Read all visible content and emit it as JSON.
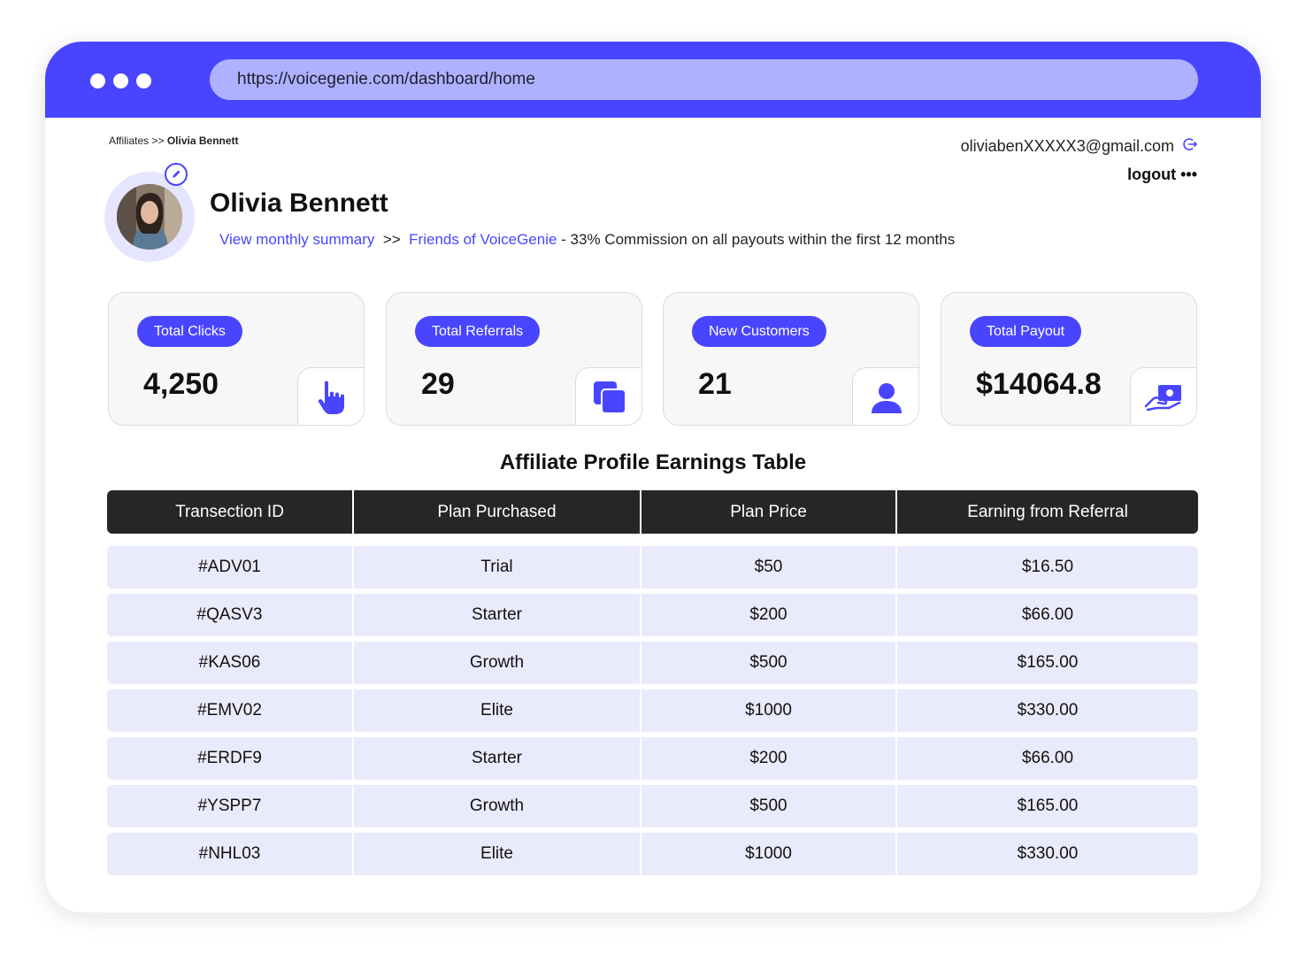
{
  "browser": {
    "url": "https://voicegenie.com/dashboard/home"
  },
  "breadcrumb": {
    "parent": "Affiliates",
    "separator": ">>",
    "current": "Olivia Bennett"
  },
  "account": {
    "email": "oliviabenXXXXX3@gmail.com",
    "logout_label": "logout •••"
  },
  "profile": {
    "name": "Olivia Bennett",
    "summary_link": "View monthly summary",
    "separator": ">>",
    "program_link": "Friends of VoiceGenie",
    "program_text": "- 33% Commission on all payouts within the first 12 months"
  },
  "stats": [
    {
      "label": "Total Clicks",
      "value": "4,250",
      "icon": "pointer-hand-icon"
    },
    {
      "label": "Total Referrals",
      "value": "29",
      "icon": "copy-squares-icon"
    },
    {
      "label": "New Customers",
      "value": "21",
      "icon": "user-icon"
    },
    {
      "label": "Total Payout",
      "value": "$14064.8",
      "icon": "cash-hand-icon"
    }
  ],
  "table": {
    "title": "Affiliate Profile Earnings Table",
    "columns": [
      "Transection ID",
      "Plan Purchased",
      "Plan Price",
      "Earning from Referral"
    ],
    "rows": [
      [
        "#ADV01",
        "Trial",
        "$50",
        "$16.50"
      ],
      [
        "#QASV3",
        "Starter",
        "$200",
        "$66.00"
      ],
      [
        "#KAS06",
        "Growth",
        "$500",
        "$165.00"
      ],
      [
        "#EMV02",
        "Elite",
        "$1000",
        "$330.00"
      ],
      [
        "#ERDF9",
        "Starter",
        "$200",
        "$66.00"
      ],
      [
        "#YSPP7",
        "Growth",
        "$500",
        "$165.00"
      ],
      [
        "#NHL03",
        "Elite",
        "$1000",
        "$330.00"
      ]
    ]
  },
  "colors": {
    "accent": "#4945ff",
    "url_bar": "#aeb1ff",
    "header_dark": "#262626",
    "row_bg": "#eaeafd"
  }
}
